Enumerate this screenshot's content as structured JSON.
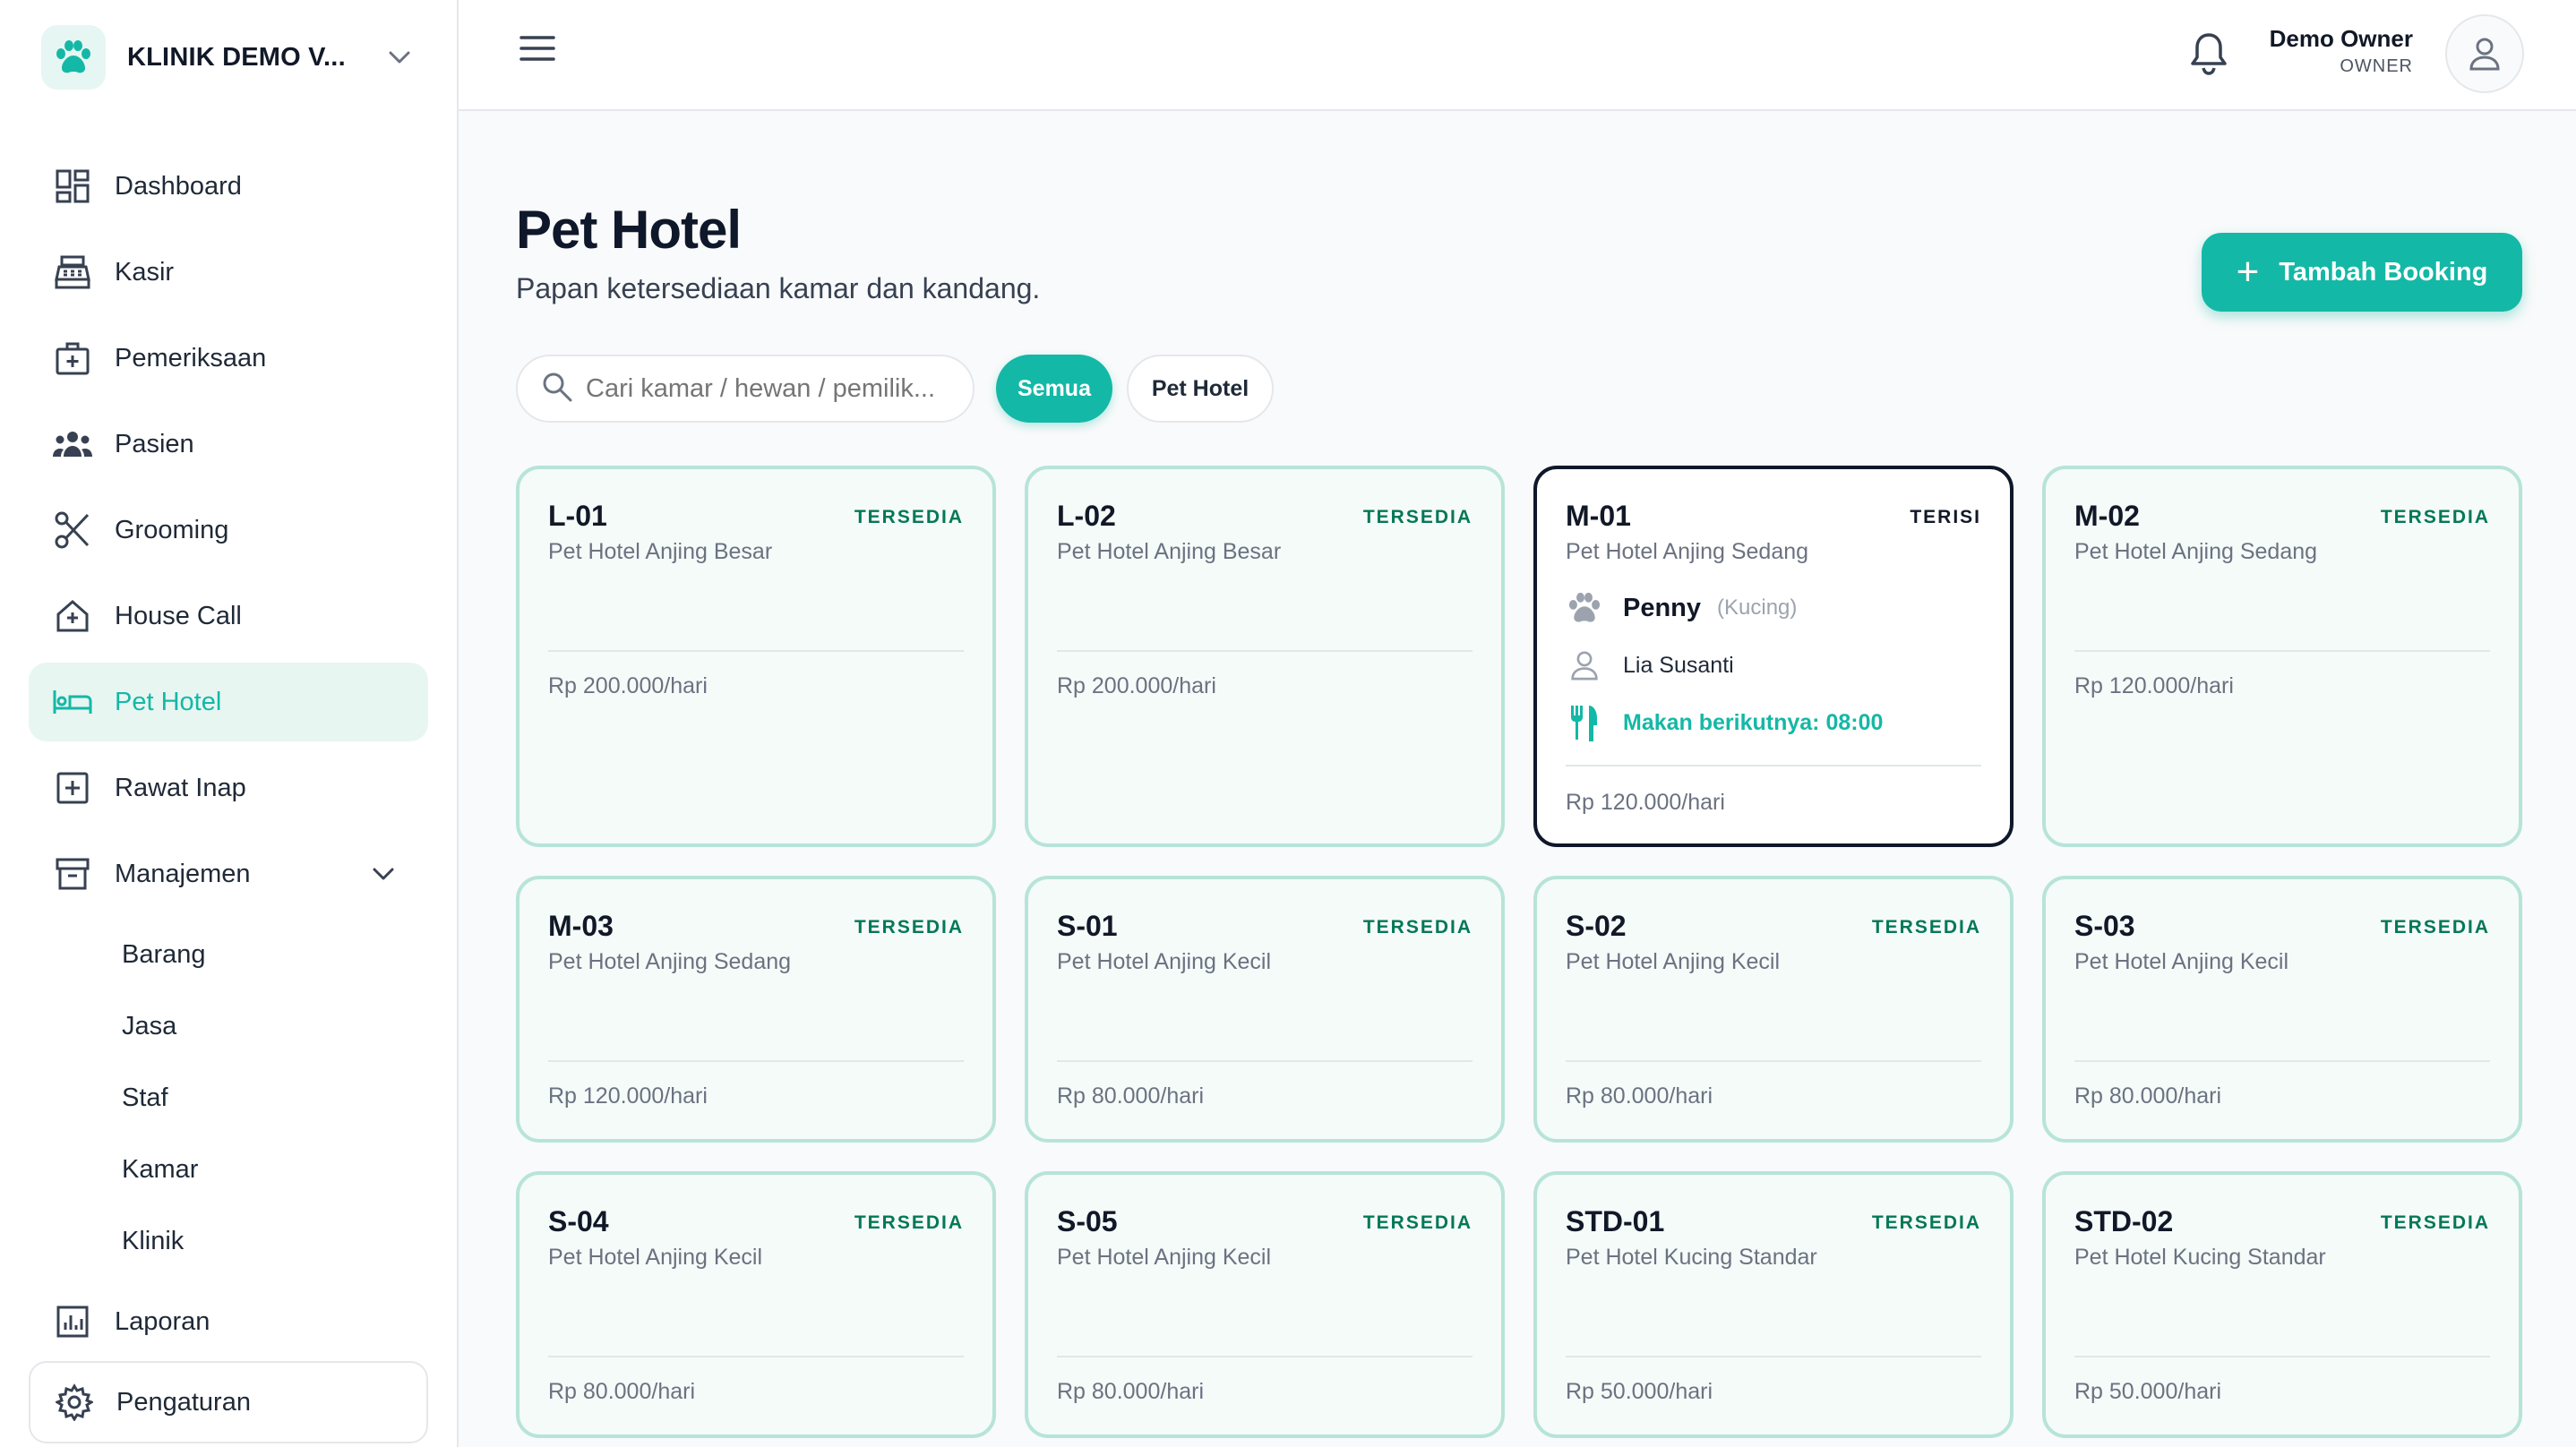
{
  "brand": {
    "name": "KLINIK DEMO V..."
  },
  "sidebar": {
    "items": [
      {
        "label": "Dashboard"
      },
      {
        "label": "Kasir"
      },
      {
        "label": "Pemeriksaan"
      },
      {
        "label": "Pasien"
      },
      {
        "label": "Grooming"
      },
      {
        "label": "House Call"
      },
      {
        "label": "Pet Hotel"
      },
      {
        "label": "Rawat Inap"
      },
      {
        "label": "Manajemen"
      },
      {
        "label": "Laporan"
      },
      {
        "label": "Pengaturan"
      }
    ],
    "management_sub": [
      "Barang",
      "Jasa",
      "Staf",
      "Kamar",
      "Klinik"
    ]
  },
  "user": {
    "name": "Demo Owner",
    "role": "OWNER"
  },
  "page": {
    "title": "Pet Hotel",
    "subtitle": "Papan ketersediaan kamar dan kandang.",
    "add_button": "Tambah Booking"
  },
  "filters": {
    "search_placeholder": "Cari kamar / hewan / pemilik...",
    "pill_all": "Semua",
    "pill_hotel": "Pet Hotel"
  },
  "rooms": [
    {
      "code": "L-01",
      "status": "TERSEDIA",
      "type": "Pet Hotel Anjing Besar",
      "price": "Rp 200.000/hari"
    },
    {
      "code": "L-02",
      "status": "TERSEDIA",
      "type": "Pet Hotel Anjing Besar",
      "price": "Rp 200.000/hari"
    },
    {
      "code": "M-01",
      "status": "TERISI",
      "type": "Pet Hotel Anjing Sedang",
      "price": "Rp 120.000/hari",
      "pet_name": "Penny",
      "pet_species": "(Kucing)",
      "owner": "Lia Susanti",
      "next_meal": "Makan berikutnya: 08:00"
    },
    {
      "code": "M-02",
      "status": "TERSEDIA",
      "type": "Pet Hotel Anjing Sedang",
      "price": "Rp 120.000/hari"
    },
    {
      "code": "M-03",
      "status": "TERSEDIA",
      "type": "Pet Hotel Anjing Sedang",
      "price": "Rp 120.000/hari"
    },
    {
      "code": "S-01",
      "status": "TERSEDIA",
      "type": "Pet Hotel Anjing Kecil",
      "price": "Rp 80.000/hari"
    },
    {
      "code": "S-02",
      "status": "TERSEDIA",
      "type": "Pet Hotel Anjing Kecil",
      "price": "Rp 80.000/hari"
    },
    {
      "code": "S-03",
      "status": "TERSEDIA",
      "type": "Pet Hotel Anjing Kecil",
      "price": "Rp 80.000/hari"
    },
    {
      "code": "S-04",
      "status": "TERSEDIA",
      "type": "Pet Hotel Anjing Kecil",
      "price": "Rp 80.000/hari"
    },
    {
      "code": "S-05",
      "status": "TERSEDIA",
      "type": "Pet Hotel Anjing Kecil",
      "price": "Rp 80.000/hari"
    },
    {
      "code": "STD-01",
      "status": "TERSEDIA",
      "type": "Pet Hotel Kucing Standar",
      "price": "Rp 50.000/hari"
    },
    {
      "code": "STD-02",
      "status": "TERSEDIA",
      "type": "Pet Hotel Kucing Standar",
      "price": "Rp 50.000/hari"
    }
  ],
  "colors": {
    "accent": "#14b8a6",
    "available": "#047857",
    "active_bg": "#e8f6f2"
  },
  "icons": [
    "paw-icon",
    "chevron-down-icon",
    "dashboard-icon",
    "cash-register-icon",
    "medical-kit-icon",
    "users-icon",
    "scissors-icon",
    "house-medical-icon",
    "bed-icon",
    "plus-square-icon",
    "archive-icon",
    "chart-icon",
    "gear-icon",
    "menu-icon",
    "bell-icon",
    "user-icon",
    "search-icon",
    "plus-icon",
    "utensils-icon"
  ]
}
